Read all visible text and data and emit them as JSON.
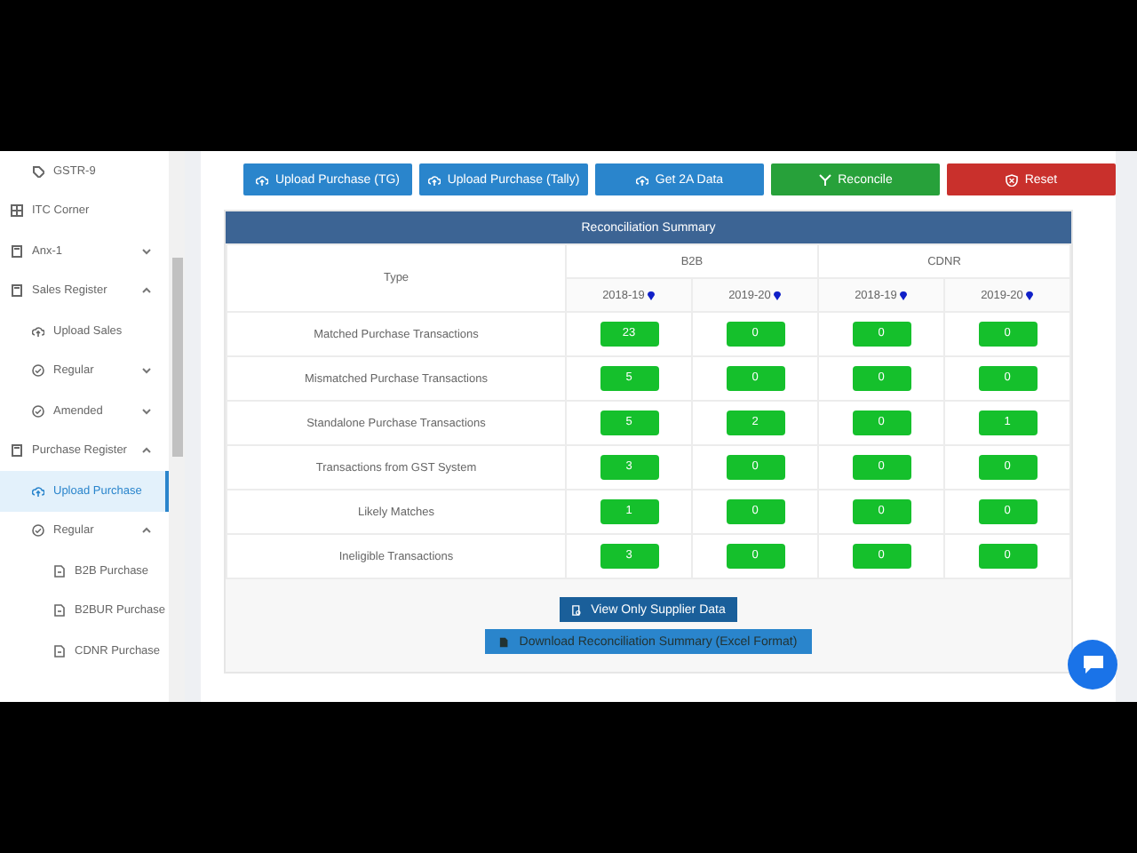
{
  "sidebar": {
    "items": [
      {
        "children": [
          {
            "label": "GSTR-9",
            "kind": "tag"
          }
        ]
      },
      {
        "label": "ITC Corner",
        "kind": "grid"
      },
      {
        "label": "Anx-1",
        "kind": "register",
        "expanded": false
      },
      {
        "label": "Sales Register",
        "kind": "register",
        "expanded": true,
        "children": [
          {
            "label": "Upload Sales",
            "kind": "upload",
            "selected": false
          },
          {
            "label": "Regular",
            "kind": "check",
            "expanded": false
          },
          {
            "label": "Amended",
            "kind": "check",
            "expanded": false
          }
        ]
      },
      {
        "label": "Purchase Register",
        "kind": "register",
        "expanded": true,
        "children": [
          {
            "label": "Upload Purchase",
            "kind": "upload",
            "selected": true
          },
          {
            "label": "Regular",
            "kind": "check",
            "expanded": true,
            "children": [
              {
                "label": "B2B Purchase",
                "kind": "file"
              },
              {
                "label": "B2BUR Purchase",
                "kind": "file"
              },
              {
                "label": "CDNR Purchase",
                "kind": "file"
              }
            ]
          }
        ]
      }
    ]
  },
  "actions": [
    {
      "label": "Upload Purchase (TG)",
      "kind": "upload",
      "color": "#2a85cc"
    },
    {
      "label": "Upload Purchase (Tally)",
      "kind": "upload",
      "color": "#2a85cc"
    },
    {
      "label": "Get 2A Data",
      "kind": "upload",
      "color": "#2a85cc"
    },
    {
      "label": "Reconcile",
      "kind": "filter",
      "color": "#27a13a"
    },
    {
      "label": "Reset",
      "kind": "reset",
      "color": "#c9302c"
    }
  ],
  "summary": {
    "title": "Reconciliation Summary",
    "type_header": "Type",
    "groups": [
      {
        "label": "B2B",
        "years": [
          "2018-19",
          "2019-20"
        ]
      },
      {
        "label": "CDNR",
        "years": [
          "2018-19",
          "2019-20"
        ]
      }
    ],
    "rows": [
      {
        "label": "Matched Purchase Transactions",
        "values": [
          "23",
          "0",
          "0",
          "0"
        ]
      },
      {
        "label": "Mismatched Purchase Transactions",
        "values": [
          "5",
          "0",
          "0",
          "0"
        ]
      },
      {
        "label": "Standalone Purchase Transactions",
        "values": [
          "5",
          "2",
          "0",
          "1"
        ]
      },
      {
        "label": "Transactions from GST System",
        "values": [
          "3",
          "0",
          "0",
          "0"
        ]
      },
      {
        "label": "Likely Matches",
        "values": [
          "1",
          "0",
          "0",
          "0"
        ]
      },
      {
        "label": "Ineligible Transactions",
        "values": [
          "3",
          "0",
          "0",
          "0"
        ]
      }
    ],
    "buttons": [
      {
        "label": "View Only Supplier Data",
        "kind": "view"
      },
      {
        "label": "Download Reconciliation Summary (Excel Format)",
        "kind": "download"
      }
    ]
  }
}
